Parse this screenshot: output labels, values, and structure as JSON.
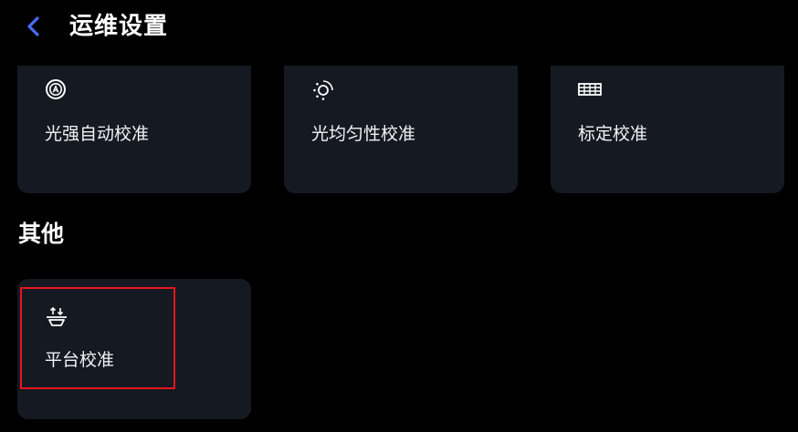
{
  "header": {
    "title": "运维设置",
    "back_icon": "chevron-left-icon",
    "accent_color": "#4a6cf7"
  },
  "cards": [
    {
      "label": "光强自动校准",
      "icon": "auto-intensity-icon"
    },
    {
      "label": "光均匀性校准",
      "icon": "light-uniformity-icon"
    },
    {
      "label": "标定校准",
      "icon": "grid-icon"
    }
  ],
  "other_section": {
    "title": "其他",
    "cards": [
      {
        "label": "平台校准",
        "icon": "platform-calibrate-icon"
      }
    ]
  },
  "colors": {
    "background": "#000000",
    "card_background": "#151922",
    "highlight": "#e5161c"
  }
}
